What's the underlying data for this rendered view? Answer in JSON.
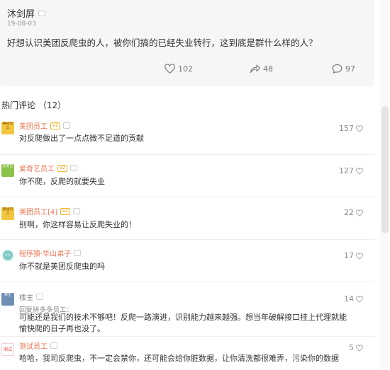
{
  "post": {
    "author": "沐剑屏",
    "date": "19-08-03",
    "text": "好想认识美团反爬虫的人，被你们搞的已经失业转行，这到底是群什么样的人？",
    "likes": "102",
    "shares": "48",
    "comments": "97"
  },
  "hot_comments_title": "热门评论 （12）",
  "comments": [
    {
      "name": "美团员工",
      "avatar_text": "美团员工",
      "avatar_color": "#f3c640",
      "vip": "V2",
      "text": "对反爬做出了一点点微不足道的贡献",
      "likes": "157"
    },
    {
      "name": "爱奇艺员工",
      "avatar_text": "爱奇艺",
      "avatar_color": "#8bc34a",
      "vip": "V2",
      "text": "你不爬，反爬的就要失业",
      "likes": "127"
    },
    {
      "name": "美团员工[4]",
      "avatar_text": "美团员工",
      "avatar_color": "#f3c640",
      "vip": "V2",
      "text": "别啊，你这样容易让反爬失业的！",
      "likes": "22"
    },
    {
      "name": "程序猿·华山弟子",
      "avatar_text": "",
      "avatar_color": "#7ecbc6",
      "vip": "",
      "text": "你不就是美团反爬虫的吗",
      "likes": "17"
    },
    {
      "name": "楼主",
      "avatar_text": "楼主",
      "avatar_color": "#6f8fb5",
      "vip": "",
      "reply_to": "回复拼多多员工：",
      "text": "可能还是我们的技术不够吧！反爬一路演进，识别能力越来越强。想当年破解接口挂上代理就能愉快爬的日子再也没了。",
      "likes": "14"
    },
    {
      "name": "测试员工",
      "avatar_text": "测试",
      "avatar_color": "#ffffff",
      "vip": "",
      "text": "哈哈，我司反爬虫，不一定会禁你，还可能会给你脏数据，让你清洗都很难弄，污染你的数据",
      "likes": "5"
    }
  ]
}
